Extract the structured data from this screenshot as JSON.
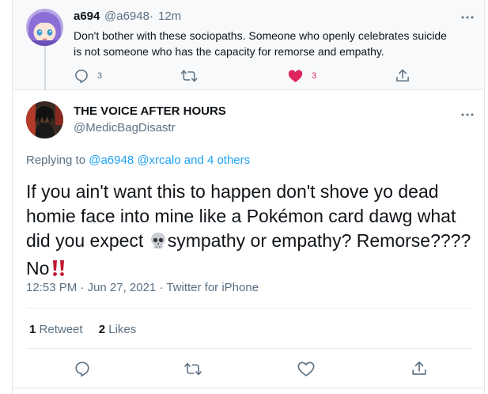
{
  "reply_tweet": {
    "display_name": "a694",
    "handle": "@a6948",
    "separator": "·",
    "time": "12m",
    "text_line1": "Don't bother with these sociopaths. Someone who openly celebrates suicide",
    "text_line2": "is not someone who has the capacity for remorse and empathy.",
    "reply_count": "3",
    "like_count": "3",
    "like_color": "#e0245e",
    "icons": [
      "reply-icon",
      "retweet-icon",
      "heart-icon",
      "share-icon",
      "more-icon"
    ]
  },
  "main_tweet": {
    "display_name": "THE VOICE AFTER HOURS",
    "handle": "@MedicBagDisastr",
    "replying_prefix": "Replying to",
    "replying_users": "@a6948 @xrcalo",
    "replying_suffix": "and 4 others",
    "text_line1": "If you ain't want this to happen don't shove yo dead",
    "text_line2": "homie face into mine like a Pokémon card dawg what",
    "text_line3_a": "did you expect",
    "text_line3_b": "sympathy or empathy? Remorse????",
    "text_line4": "No",
    "timestamp": "12:53 PM · Jun 27, 2021 · Twitter for iPhone",
    "retweet_count": "1",
    "retweet_label": "Retweet",
    "like_count": "2",
    "like_label": "Likes",
    "link_color": "#1da1f2",
    "emoji": [
      "skull-emoji",
      "double-exclamation-emoji"
    ]
  }
}
